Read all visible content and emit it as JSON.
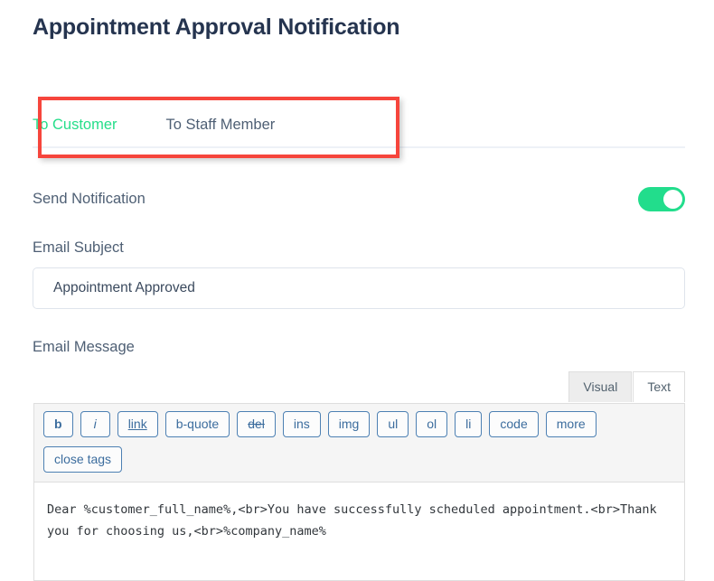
{
  "page": {
    "title": "Appointment Approval Notification"
  },
  "tabs": {
    "items": [
      {
        "label": "To Customer",
        "active": true
      },
      {
        "label": "To Staff Member",
        "active": false
      }
    ],
    "active_color": "#25de8a",
    "inactive_color": "#4e5f74"
  },
  "annotation": {
    "color": "#f6453c",
    "target": "tabs"
  },
  "notification": {
    "label": "Send Notification",
    "toggle_state": "on",
    "toggle_color": "#22dd8c"
  },
  "subject": {
    "label": "Email Subject",
    "value": "Appointment Approved",
    "placeholder": "Email Subject"
  },
  "message": {
    "label": "Email Message",
    "editor_tabs": [
      {
        "label": "Visual",
        "active": false
      },
      {
        "label": "Text",
        "active": true
      }
    ],
    "toolbar_row_1": [
      "b",
      "i",
      "link",
      "b-quote",
      "del",
      "ins",
      "img",
      "ul",
      "ol",
      "li",
      "code",
      "more"
    ],
    "toolbar_row_2": [
      "close tags"
    ],
    "value": "Dear %customer_full_name%,<br>You have successfully scheduled appointment.<br>Thank you for choosing us,<br>%company_name%",
    "placeholder": "Email Message"
  }
}
